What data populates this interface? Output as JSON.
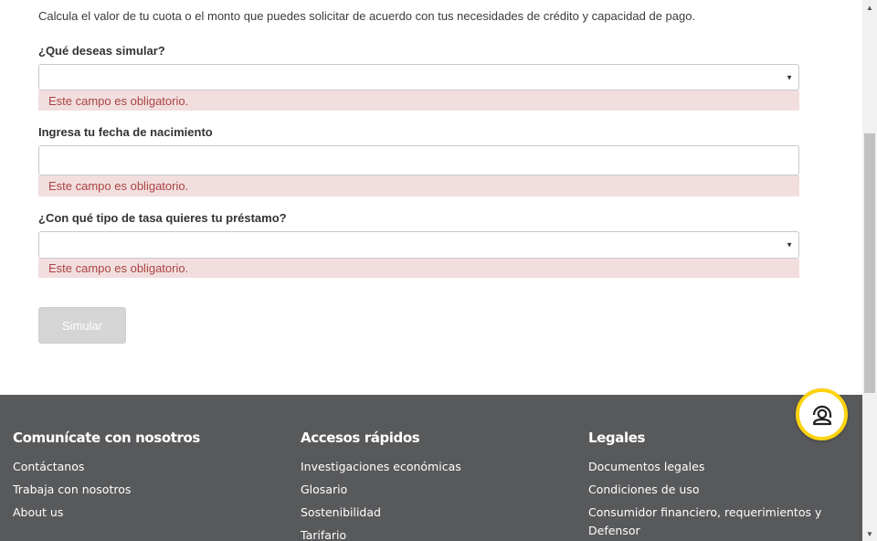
{
  "intro_text": "Calcula el valor de tu cuota o el monto que puedes solicitar de acuerdo con tus necesidades de crédito y capacidad de pago.",
  "form": {
    "simulate": {
      "label": "¿Qué deseas simular?",
      "value": "",
      "arrow": "▼",
      "error": "Este campo es obligatorio."
    },
    "birthdate": {
      "label": "Ingresa tu fecha de nacimiento",
      "value": "",
      "error": "Este campo es obligatorio."
    },
    "rate_type": {
      "label": "¿Con qué tipo de tasa quieres tu préstamo?",
      "value": "",
      "arrow": "▼",
      "error": "Este campo es obligatorio."
    },
    "submit_label": "Simular"
  },
  "footer": {
    "columns": [
      {
        "title": "Comunícate con nosotros",
        "links": [
          "Contáctanos",
          "Trabaja con nosotros",
          "About us"
        ]
      },
      {
        "title": "Accesos rápidos",
        "links": [
          "Investigaciones económicas",
          "Glosario",
          "Sostenibilidad",
          "Tarifario"
        ]
      },
      {
        "title": "Legales",
        "links": [
          "Documentos legales",
          "Condiciones de uso",
          "Consumidor financiero, requerimientos y Defensor"
        ]
      }
    ]
  },
  "chat_widget": {
    "icon": "chat-agent-icon",
    "accent_color": "#fdd30f"
  },
  "scrollbar": {
    "up_arrow": "▲",
    "down_arrow": "▼"
  },
  "colors": {
    "error_background": "#f2dede",
    "error_text": "#a94442",
    "footer_background": "#58595b",
    "disabled_button": "#d5d5d5"
  }
}
